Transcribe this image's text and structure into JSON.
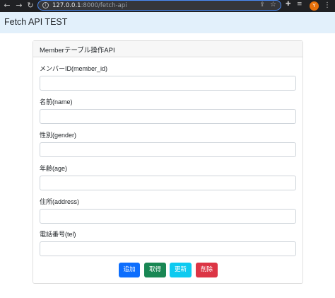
{
  "browser": {
    "url_host": "127.0.0.1",
    "url_path": ":8000/fetch-api",
    "avatar_letter": "Y"
  },
  "app": {
    "brand": "Fetch API TEST"
  },
  "card": {
    "header": "Memberテーブル操作API",
    "fields": [
      {
        "label": "メンバーID(member_id)",
        "value": ""
      },
      {
        "label": "名前(name)",
        "value": ""
      },
      {
        "label": "性別(gender)",
        "value": ""
      },
      {
        "label": "年齢(age)",
        "value": ""
      },
      {
        "label": "住所(address)",
        "value": ""
      },
      {
        "label": "電話番号(tel)",
        "value": ""
      }
    ],
    "buttons": {
      "add": "追加",
      "get": "取得",
      "update": "更新",
      "delete": "削除"
    }
  },
  "colors": {
    "navbar": "#e2f0fb",
    "add": "#0d6efd",
    "get": "#198754",
    "update": "#0dcaf0",
    "delete": "#dc3545"
  }
}
